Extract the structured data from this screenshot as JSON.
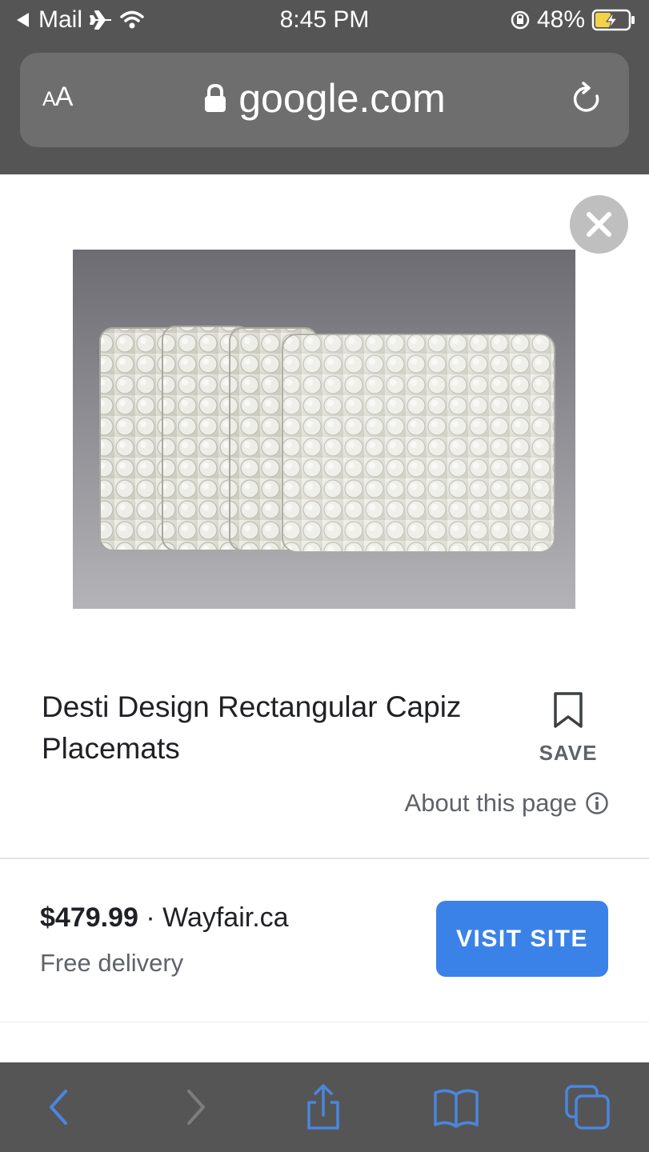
{
  "status_bar": {
    "back_app_label": "Mail",
    "time": "8:45 PM",
    "battery_percent": "48%",
    "battery_level": 0.48,
    "icons": [
      "back-arrow-icon",
      "airplane-icon",
      "wifi-icon",
      "orientation-lock-icon",
      "battery-charging-icon"
    ]
  },
  "browser": {
    "reader_button_label_small": "A",
    "reader_button_label_large": "A",
    "url": "google.com",
    "icons": [
      "lock-icon",
      "reload-icon"
    ]
  },
  "product": {
    "title": "Desti Design Rectangular Capiz Placemats",
    "save_label": "SAVE",
    "about_label": "About this page",
    "price": "$479.99",
    "separator": " · ",
    "store": "Wayfair.ca",
    "delivery": "Free delivery",
    "visit_label": "VISIT SITE",
    "icons": [
      "close-icon",
      "bookmark-icon",
      "info-icon"
    ]
  },
  "toolbar": {
    "icons": [
      "back-icon",
      "forward-icon",
      "share-icon",
      "bookmarks-icon",
      "tabs-icon"
    ]
  },
  "colors": {
    "chrome": "#555555",
    "url_bar": "#6e6e6e",
    "accent_blue": "#3b82e8",
    "toolbar_icon": "#4a86e0",
    "toolbar_icon_disabled": "#7d7d7d"
  }
}
